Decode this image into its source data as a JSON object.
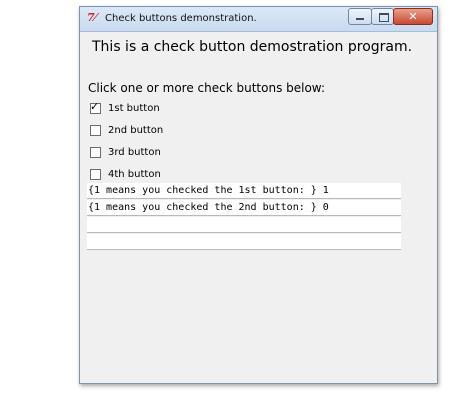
{
  "window": {
    "title": "Check buttons demonstration.",
    "app_icon": "tk-feather-icon",
    "controls": {
      "minimize": "minimize-icon",
      "maximize": "maximize-icon",
      "close": "close-icon",
      "close_glyph": "✕"
    }
  },
  "heading": "This is a check button demostration program.",
  "instruction": "Click one or more check buttons below:",
  "check_buttons": [
    {
      "label": "1st button",
      "checked": true
    },
    {
      "label": "2nd button",
      "checked": false
    },
    {
      "label": "3rd button",
      "checked": false
    },
    {
      "label": "4th button",
      "checked": false
    }
  ],
  "output_log": [
    "{1 means you checked the 1st button: } 1",
    "{1 means you checked the 2nd button: } 0",
    "",
    ""
  ],
  "colors": {
    "window_bg": "#f0f0f0",
    "titlebar": "#c9dbf0",
    "close_button": "#c64a33",
    "tk_icon": "#d62020"
  }
}
